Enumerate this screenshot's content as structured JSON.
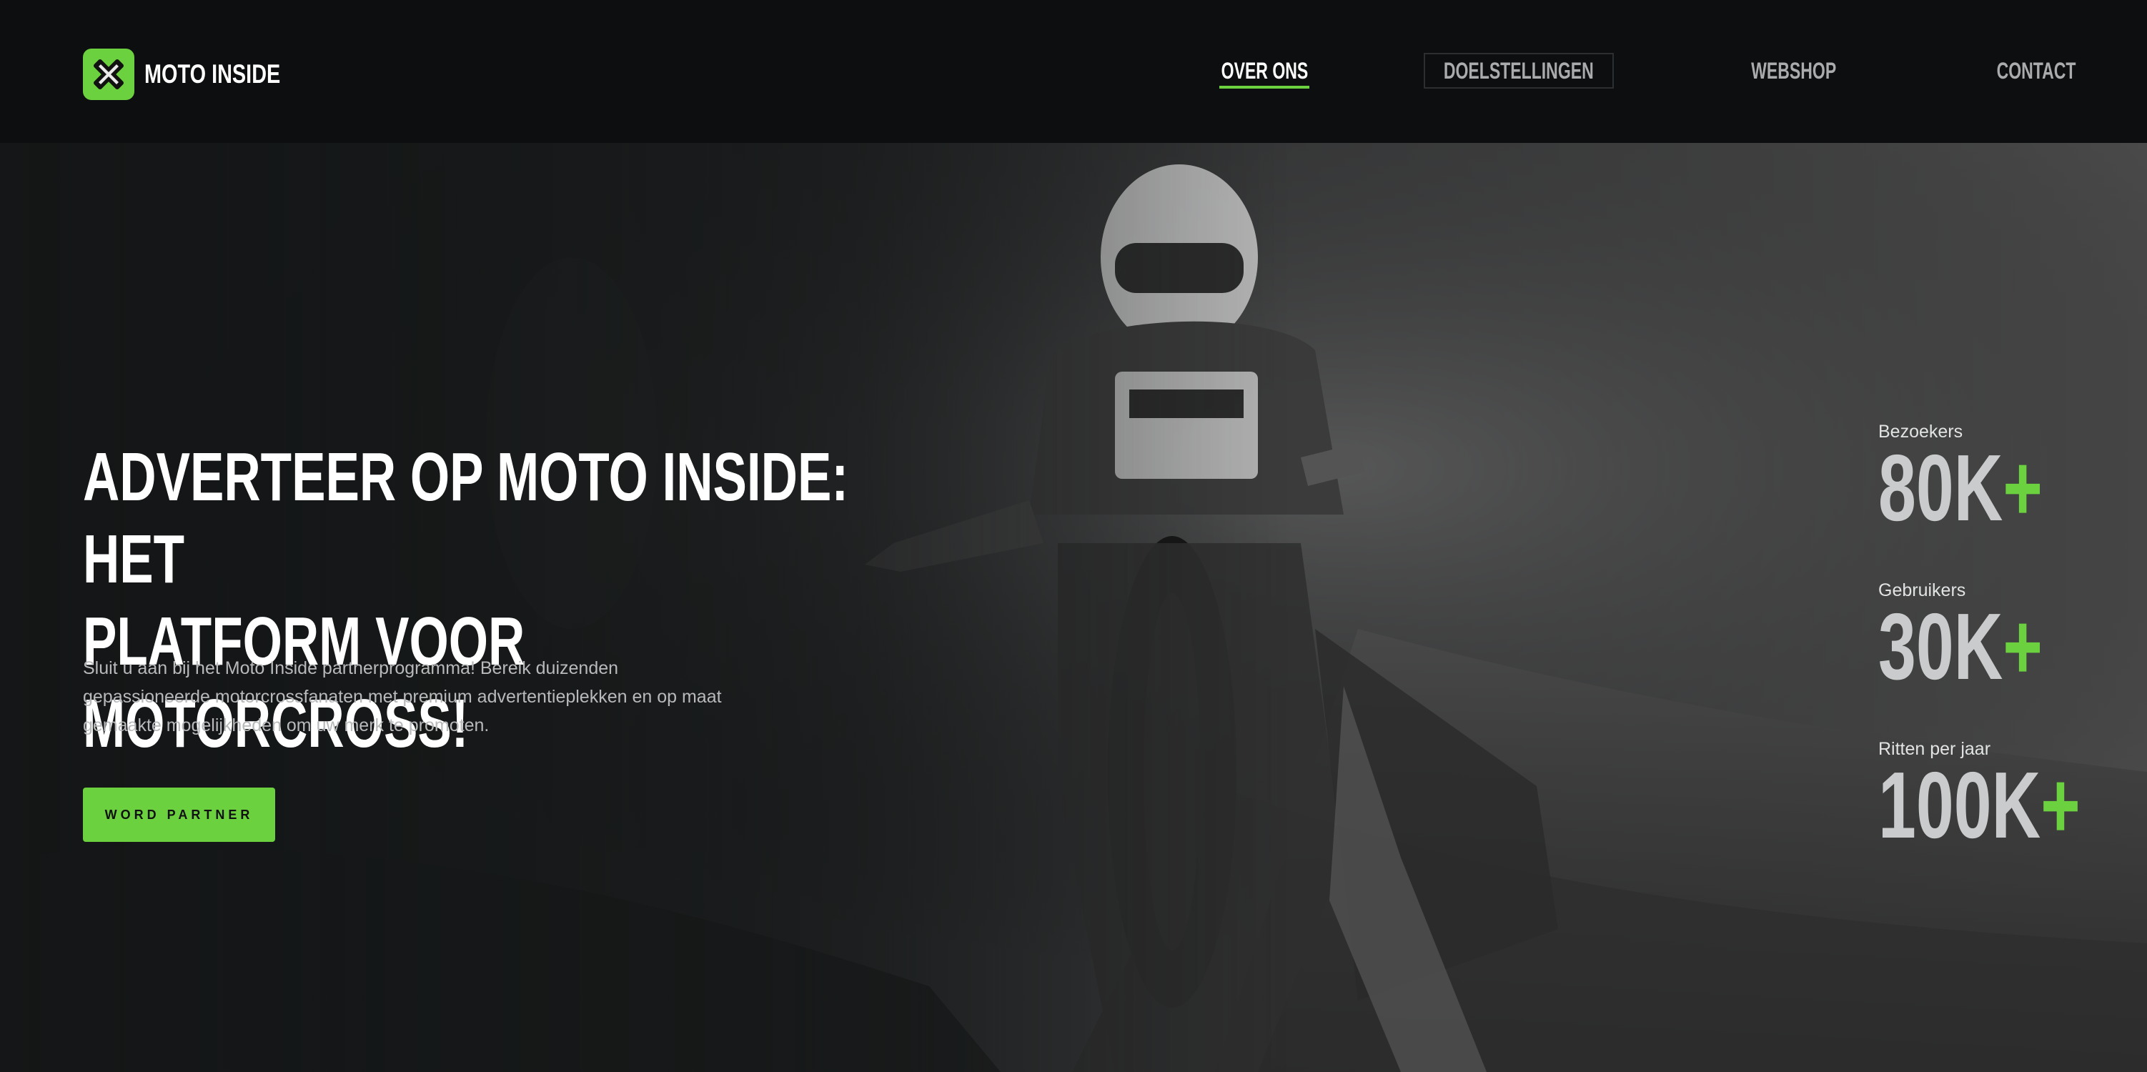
{
  "brand": {
    "name": "MOTO INSIDE",
    "accent": "#6bd13f"
  },
  "nav": {
    "items": [
      {
        "label": "OVER ONS",
        "active": true
      },
      {
        "label": "DOELSTELLINGEN",
        "active": false
      },
      {
        "label": "WEBSHOP",
        "active": false
      },
      {
        "label": "CONTACT",
        "active": false
      }
    ]
  },
  "hero": {
    "title_line1": "ADVERTEER OP MOTO INSIDE: HET",
    "title_line2": "PLATFORM VOOR MOTORCROSS!",
    "text": "Sluit u aan bij het Moto Inside partnerprogramma! Bereik duizenden gepassioneerde motorcrossfanaten met premium advertentieplekken en op maat gemaakte mogelijkheden om uw merk te promoten.",
    "cta_label": "WORD PARTNER"
  },
  "stats": [
    {
      "label": "Bezoekers",
      "value": "80K",
      "suffix": "+"
    },
    {
      "label": "Gebruikers",
      "value": "30K",
      "suffix": "+"
    },
    {
      "label": "Ritten per jaar",
      "value": "100K",
      "suffix": "+"
    }
  ],
  "icons": {
    "logo": "x-cross-logo-icon"
  }
}
